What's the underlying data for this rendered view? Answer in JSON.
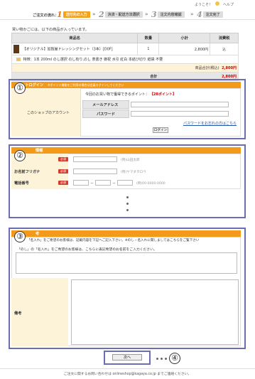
{
  "header": {
    "welcome": "ようこそ！",
    "help": "ヘルプ"
  },
  "steps": {
    "label": "ご注文の流れ：",
    "items": [
      {
        "num": "1",
        "label": "送付先の入力"
      },
      {
        "num": "2",
        "label": "決済・配送方法選択"
      },
      {
        "num": "3",
        "label": "注文内容確認"
      },
      {
        "num": "4",
        "label": "注文完了"
      }
    ]
  },
  "cart": {
    "intro": "買い物かごには、以下の商品が入っています。",
    "headers": {
      "product": "商品名",
      "qty": "数量",
      "subtotal": "小計",
      "tax": "消費税"
    },
    "item": {
      "name": "【オリジナル】加賀屋ドレッシングセット（3本）[D0F]",
      "qty": "1",
      "subtotal": "2,800円",
      "tax": "込"
    },
    "options": "特徴：1本 200ml のし選択 のし有り,のし 表書き 御祝 水引 紅白 本結び切り 紙袋 不要",
    "total_incl_label": "商品合計(税込)",
    "total_incl_value": "2,800円",
    "total_label": "合計",
    "total_value": "2,800円"
  },
  "login": {
    "title": "ットログイン",
    "title_note": "※ポイント機能をご利用の場合は会員ログインしてください",
    "left_label": "このショップのアカウント",
    "points_text": "今回のお買い物で獲得できるポイント：",
    "points_value": "【28ポイント】",
    "email_label": "メールアドレス",
    "password_label": "パスワード",
    "forgot": "パスワードをお忘れの方はこちら",
    "button": "ログイン"
  },
  "address": {
    "title": "情報",
    "rows": [
      {
        "label": "",
        "req": "必須",
        "hint": "(例)山田太郎"
      },
      {
        "label": "お名前フリガナ",
        "req": "必須",
        "hint": "(例)ヤマダタロウ"
      },
      {
        "label": "電話番号",
        "req": "必須",
        "hint": "(例)00-0000-0000",
        "sep": "－"
      }
    ]
  },
  "note": {
    "title": "考",
    "line1": "「名入れ」をご希望のお客様は、記載内容を下記へご記入下さい。※のし・名入れに関しましてはこちらをご覧下さい",
    "line2": "「のし」の「名入れ」をご希望のお客様は、こちらに表記希望のお名前をご入力ください。",
    "remarks_label": "備考"
  },
  "footer": {
    "next_button": "次へ",
    "contact": "ご注文に関するお問い合わせは onlineshop@kagaya.co.jp までご連絡ください。"
  },
  "annotations": [
    "①",
    "②",
    "③",
    "④"
  ]
}
